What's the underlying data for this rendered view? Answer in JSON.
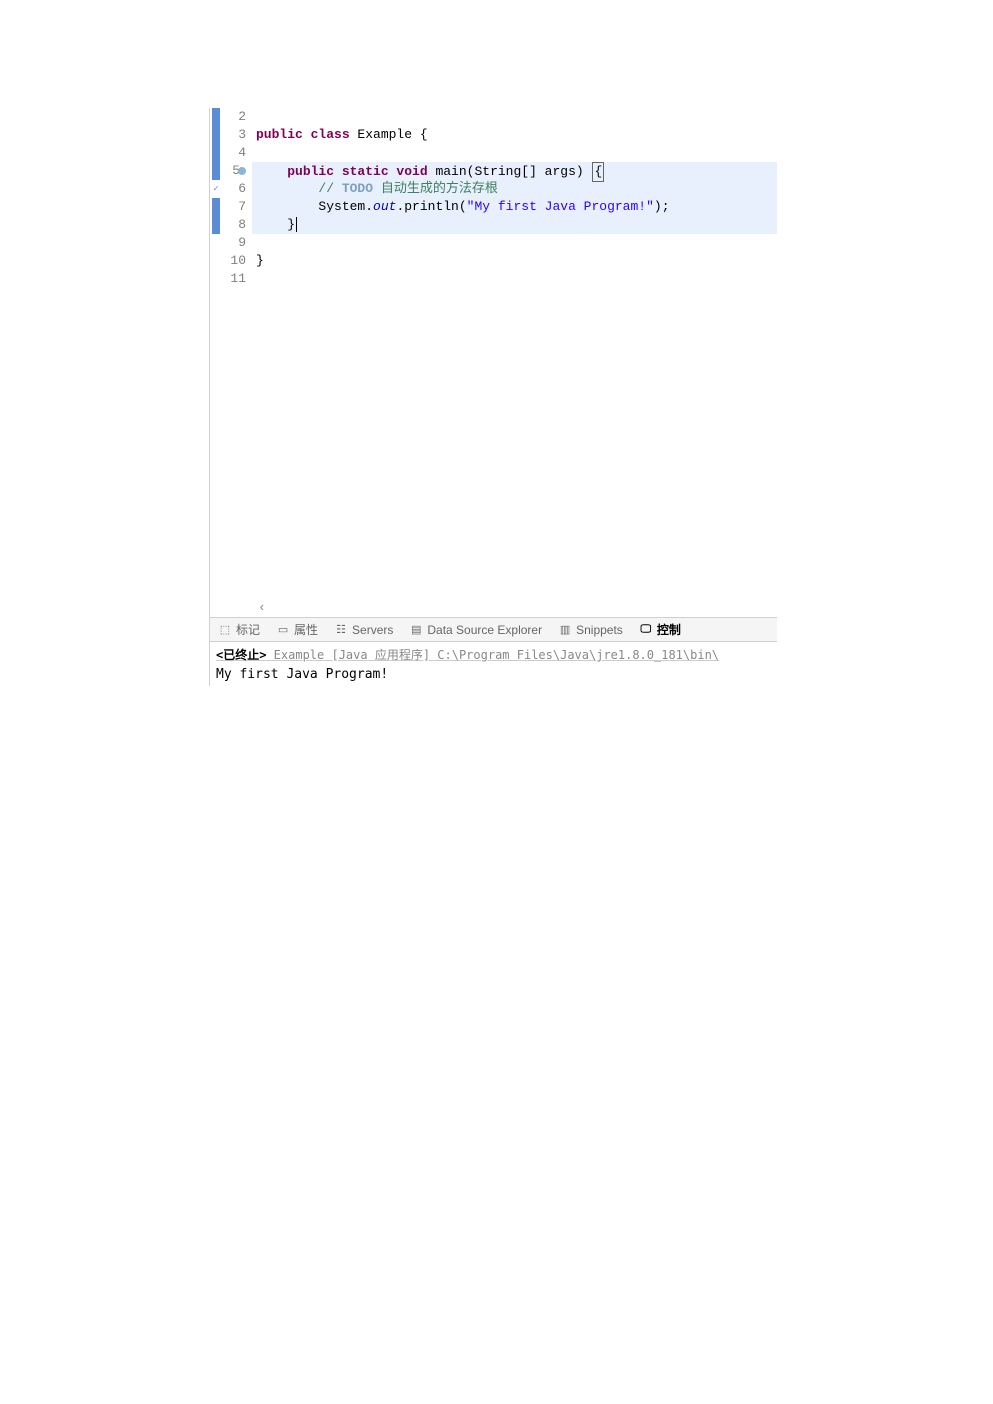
{
  "editor": {
    "lines": [
      {
        "num": "2",
        "marker": "blue",
        "code_html": ""
      },
      {
        "num": "3",
        "marker": "blue",
        "tokens": [
          {
            "cls": "kw",
            "t": "public class"
          },
          {
            "cls": "normal",
            "t": " Example {"
          }
        ]
      },
      {
        "num": "4",
        "marker": "blue",
        "code_html": ""
      },
      {
        "num": "5",
        "marker": "blue",
        "circle": true,
        "highlight": true,
        "tokens": [
          {
            "cls": "normal",
            "t": "    "
          },
          {
            "cls": "kw",
            "t": "public static void"
          },
          {
            "cls": "normal",
            "t": " main(String[] args) "
          },
          {
            "cls": "normal",
            "t": "{",
            "boxed": true
          }
        ]
      },
      {
        "num": "6",
        "marker": "task",
        "highlight": true,
        "tokens": [
          {
            "cls": "normal",
            "t": "        "
          },
          {
            "cls": "comment",
            "t": "// "
          },
          {
            "cls": "todo",
            "t": "TODO"
          },
          {
            "cls": "comment",
            "t": " 自动生成的方法存根"
          }
        ]
      },
      {
        "num": "7",
        "marker": "blue",
        "highlight": true,
        "tokens": [
          {
            "cls": "normal",
            "t": "        System."
          },
          {
            "cls": "static-field",
            "t": "out"
          },
          {
            "cls": "normal",
            "t": ".println("
          },
          {
            "cls": "string",
            "t": "\"My first Java Program!\""
          },
          {
            "cls": "normal",
            "t": ");"
          }
        ]
      },
      {
        "num": "8",
        "marker": "blue",
        "highlight": true,
        "tokens": [
          {
            "cls": "normal",
            "t": "    }",
            "cursor_after": true
          }
        ]
      },
      {
        "num": "9",
        "marker": "",
        "code_html": ""
      },
      {
        "num": "10",
        "marker": "",
        "tokens": [
          {
            "cls": "normal",
            "t": "}"
          }
        ]
      },
      {
        "num": "11",
        "marker": "",
        "code_html": ""
      }
    ],
    "scroll_left_glyph": "‹"
  },
  "tabs": {
    "items": [
      {
        "label": "标记",
        "icon": "⬚",
        "active": false
      },
      {
        "label": "属性",
        "icon": "▭",
        "active": false
      },
      {
        "label": "Servers",
        "icon": "☷",
        "active": false
      },
      {
        "label": "Data Source Explorer",
        "icon": "▤",
        "active": false
      },
      {
        "label": "Snippets",
        "icon": "▥",
        "active": false
      },
      {
        "label": "控制",
        "icon": "🖵",
        "active": true
      }
    ]
  },
  "console": {
    "header_prefix": "<已终止>",
    "header_rest": " Example [Java 应用程序] C:\\Program Files\\Java\\jre1.8.0_181\\bin\\",
    "output": "My first Java Program!"
  }
}
